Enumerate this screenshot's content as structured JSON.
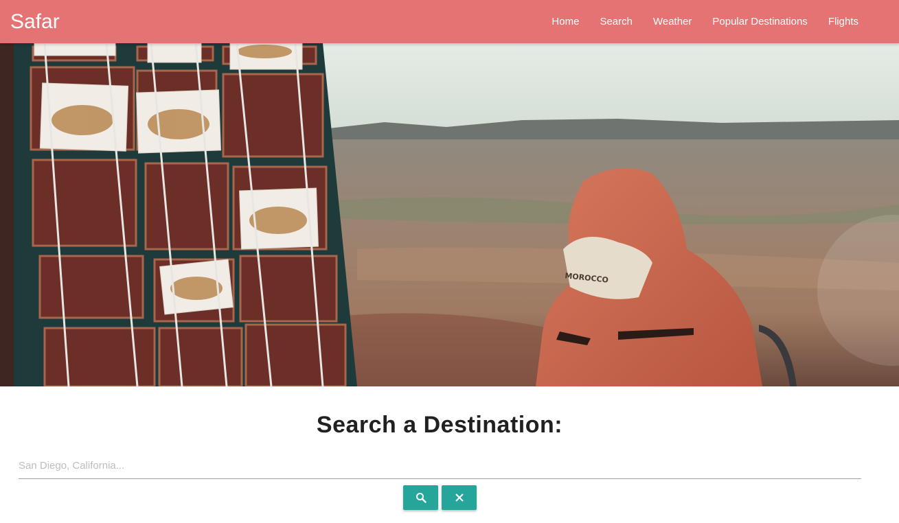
{
  "navbar": {
    "brand": "Safar",
    "links": [
      "Home",
      "Search",
      "Weather",
      "Popular Destinations",
      "Flights"
    ],
    "background": "#e57373"
  },
  "hero": {
    "cap_text": "MOROCCO"
  },
  "search": {
    "title": "Search a Destination:",
    "placeholder": "San Diego, California...",
    "value": "",
    "search_icon": "search-icon",
    "clear_icon": "close-icon",
    "button_color": "#26a69a"
  }
}
